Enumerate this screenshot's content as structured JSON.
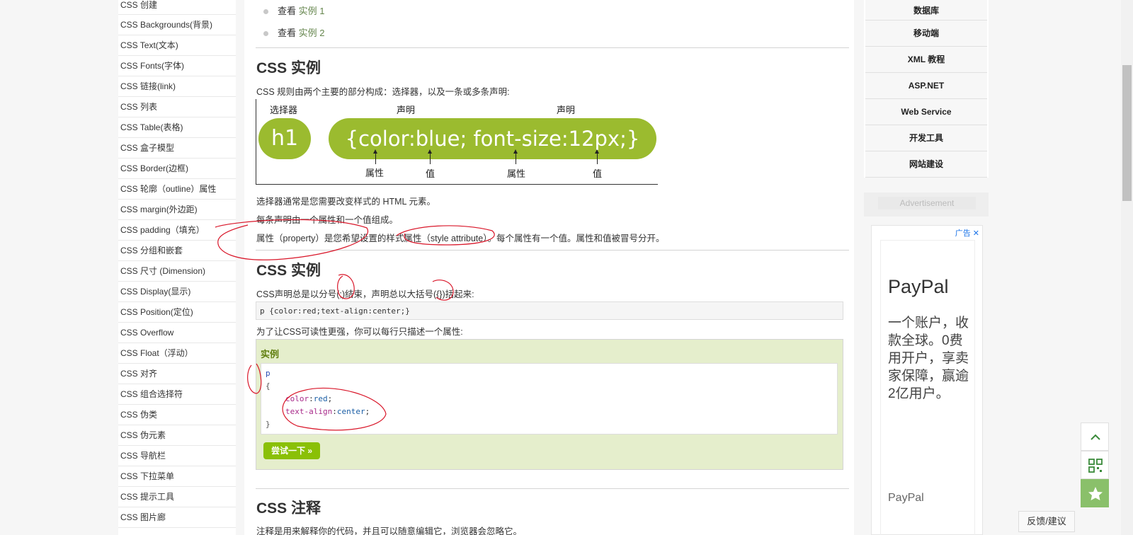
{
  "sidebar": {
    "items": [
      "CSS 创建",
      "CSS Backgrounds(背景)",
      "CSS Text(文本)",
      "CSS Fonts(字体)",
      "CSS 链接(link)",
      "CSS 列表",
      "CSS Table(表格)",
      "CSS 盒子模型",
      "CSS Border(边框)",
      "CSS 轮廓（outline）属性",
      "CSS margin(外边距)",
      "CSS padding（填充）",
      "CSS 分组和嵌套",
      "CSS 尺寸 (Dimension)",
      "CSS Display(显示)",
      "CSS Position(定位)",
      "CSS Overflow",
      "CSS Float（浮动）",
      "CSS 对齐",
      "CSS 组合选择符",
      "CSS 伪类",
      "CSS 伪元素",
      "CSS 导航栏",
      "CSS 下拉菜单",
      "CSS 提示工具",
      "CSS 图片廊"
    ]
  },
  "main": {
    "bullets": [
      {
        "prefix": "查看",
        "link": "实例 1"
      },
      {
        "prefix": "查看",
        "link": "实例 2"
      }
    ],
    "heading1": "CSS 实例",
    "intro": "CSS 规则由两个主要的部分构成：选择器，以及一条或多条声明:",
    "diagram": {
      "label_selector": "选择器",
      "label_decl1": "声明",
      "label_decl2": "声明",
      "selector": "h1",
      "declarations": "{color:blue; font-size:12px;}",
      "label_prop1": "属性",
      "label_val1": "值",
      "label_prop2": "属性",
      "label_val2": "值"
    },
    "p1": "选择器通常是您需要改变样式的 HTML 元素。",
    "p2": "每条声明由一个属性和一个值组成。",
    "p3": "属性（property）是您希望设置的样式属性（style attribute）。每个属性有一个值。属性和值被冒号分开。",
    "heading2": "CSS 实例",
    "p4": "CSS声明总是以分号(;)结束，声明总以大括号({})括起来:",
    "code1": "p {color:red;text-align:center;}",
    "p5": "为了让CSS可读性更强，你可以每行只描述一个属性:",
    "example": {
      "title": "实例",
      "selector": "p",
      "open": "{",
      "line1_prop": "color",
      "line1_val": "red",
      "line2_prop": "text-align",
      "line2_val": "center",
      "close": "}",
      "try_button": "尝试一下 »"
    },
    "heading3": "CSS 注释",
    "p6": "注释是用来解释你的代码，并且可以随意编辑它，浏览器会忽略它。"
  },
  "right_nav": {
    "items": [
      "数据库",
      "移动端",
      "XML 教程",
      "ASP.NET",
      "Web Service",
      "开发工具",
      "网站建设"
    ]
  },
  "ad": {
    "label": "Advertisement",
    "tag": "广告",
    "brand": "PayPal",
    "slogan": "一个账户，收款全球。0费用开户，享卖家保障，赢逾2亿用户。",
    "brand_small": "PayPal"
  },
  "floating": {
    "feedback": "反馈/建议"
  },
  "colors": {
    "accent_green": "#9bbb2f",
    "link_green": "#64854c",
    "try_green": "#8ac007",
    "annotation_red": "#d9172a"
  }
}
